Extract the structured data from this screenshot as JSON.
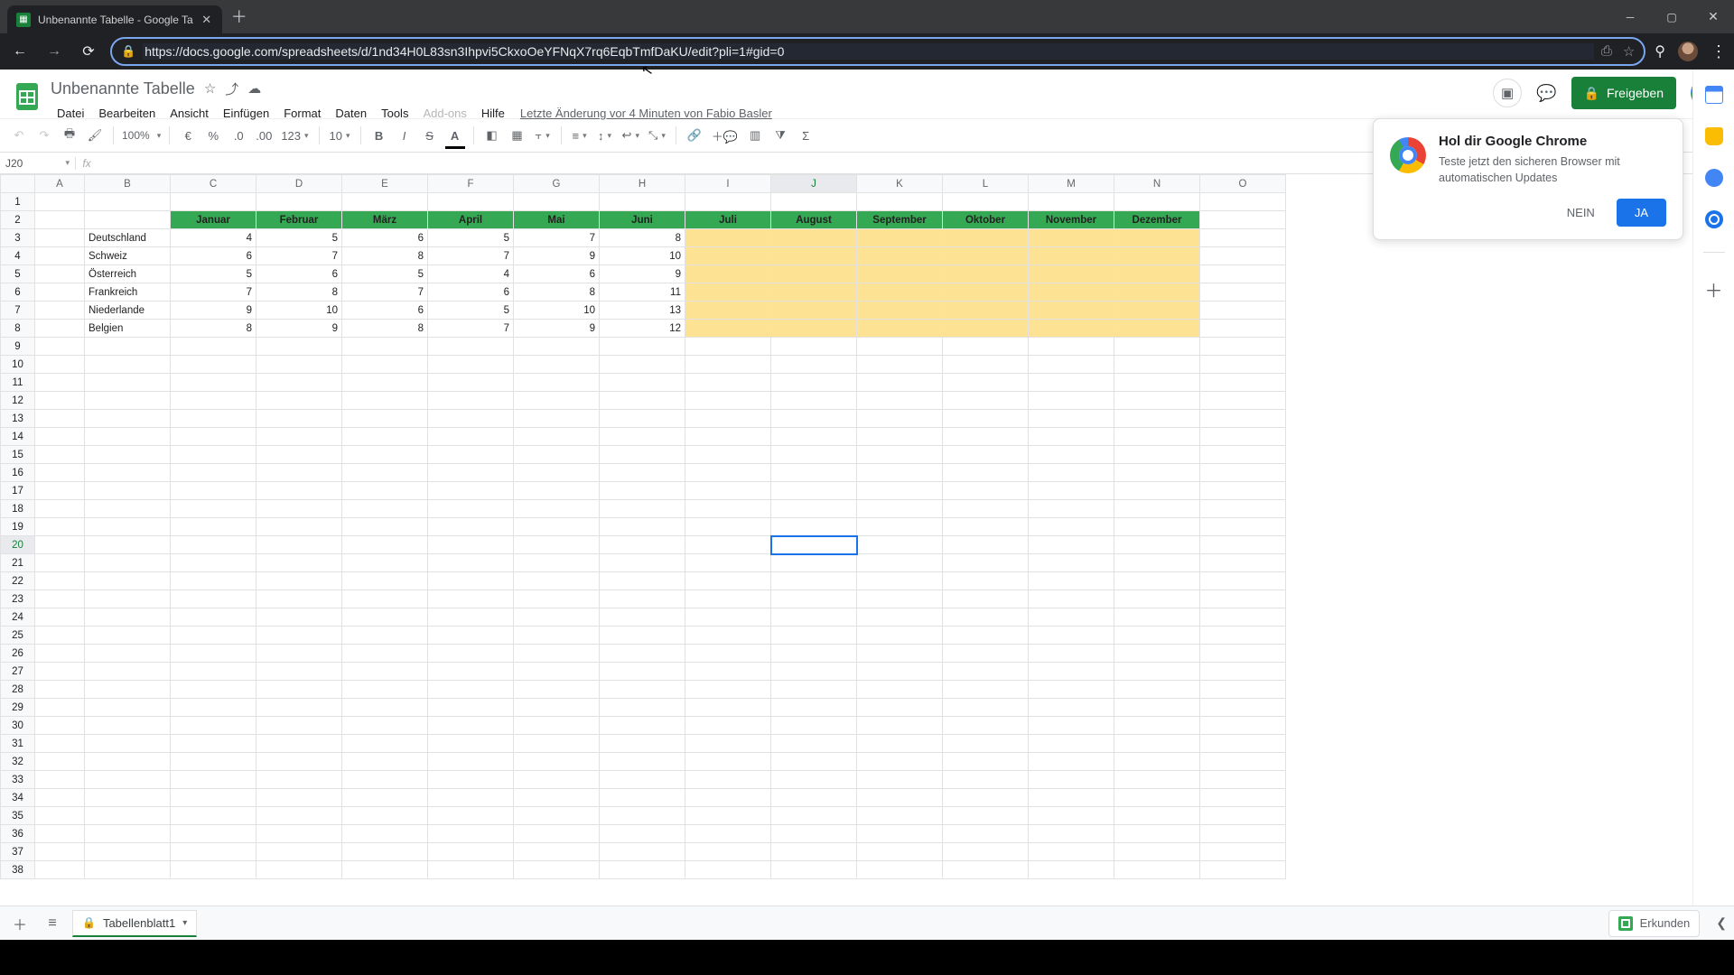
{
  "browser": {
    "tab_title": "Unbenannte Tabelle - Google Ta",
    "url": "https://docs.google.com/spreadsheets/d/1nd34H0L83sn3Ihpvi5CkxoOeYFNqX7rq6EqbTmfDaKU/edit?pli=1#gid=0"
  },
  "doc": {
    "title": "Unbenannte Tabelle",
    "menus": [
      "Datei",
      "Bearbeiten",
      "Ansicht",
      "Einfügen",
      "Format",
      "Daten",
      "Tools",
      "Add-ons",
      "Hilfe"
    ],
    "disabled_menu": "Add-ons",
    "last_edit": "Letzte Änderung vor 4 Minuten von Fabio Basler",
    "share": "Freigeben"
  },
  "toolbar": {
    "zoom": "100%",
    "currency": "€",
    "percent": "%",
    "dec_dec": ".0",
    "dec_inc": ".00",
    "numfmt": "123",
    "fontsize": "10",
    "bold": "B",
    "italic": "I",
    "strike": "S",
    "textcolor": "A"
  },
  "namebox": "J20",
  "columns": [
    "A",
    "B",
    "C",
    "D",
    "E",
    "F",
    "G",
    "H",
    "I",
    "J",
    "K",
    "L",
    "M",
    "N",
    "O"
  ],
  "months": [
    "Januar",
    "Februar",
    "März",
    "April",
    "Mai",
    "Juni",
    "Juli",
    "August",
    "September",
    "Oktober",
    "November",
    "Dezember"
  ],
  "countries": [
    "Deutschland",
    "Schweiz",
    "Österreich",
    "Frankreich",
    "Niederlande",
    "Belgien"
  ],
  "chart_data": {
    "type": "table",
    "row_labels": [
      "Deutschland",
      "Schweiz",
      "Österreich",
      "Frankreich",
      "Niederlande",
      "Belgien"
    ],
    "col_labels": [
      "Januar",
      "Februar",
      "März",
      "April",
      "Mai",
      "Juni"
    ],
    "values": [
      [
        4,
        5,
        6,
        5,
        7,
        8
      ],
      [
        6,
        7,
        8,
        7,
        9,
        10
      ],
      [
        5,
        6,
        5,
        4,
        6,
        9
      ],
      [
        7,
        8,
        7,
        6,
        8,
        11
      ],
      [
        9,
        10,
        6,
        5,
        10,
        13
      ],
      [
        8,
        9,
        8,
        7,
        9,
        12
      ]
    ]
  },
  "yellow_cols": [
    "I",
    "J",
    "K",
    "L",
    "M",
    "N"
  ],
  "selected_cell": "J20",
  "sheet_tab": "Tabellenblatt1",
  "explore": "Erkunden",
  "promo": {
    "title": "Hol dir Google Chrome",
    "body": "Teste jetzt den sicheren Browser mit automatischen Updates",
    "no": "NEIN",
    "yes": "JA"
  }
}
